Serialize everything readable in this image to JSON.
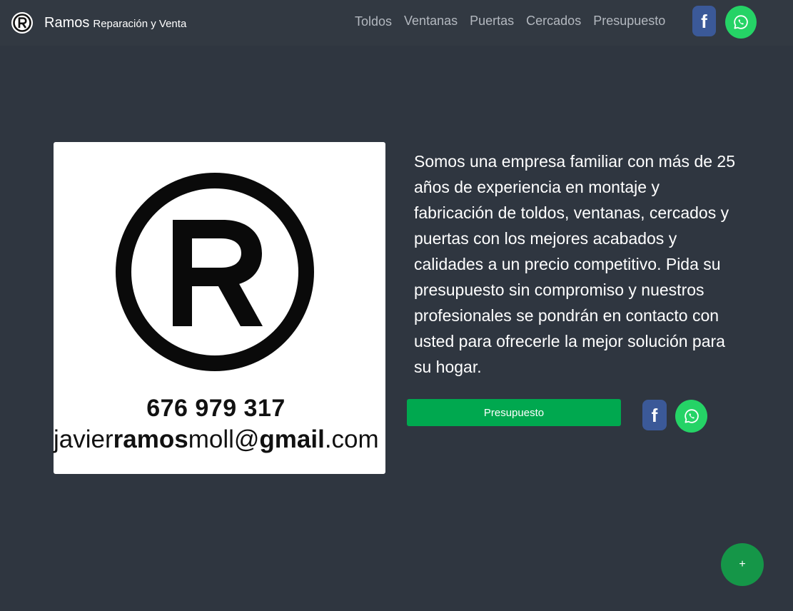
{
  "header": {
    "brand_name": "Ramos",
    "brand_sub": "Reparación y Venta",
    "nav": [
      "Toldos",
      "Ventanas",
      "Puertas",
      "Cercados",
      "Presupuesto"
    ],
    "icons": {
      "logo": "registered-trademark-icon",
      "facebook": "facebook-icon",
      "whatsapp": "whatsapp-icon"
    }
  },
  "card": {
    "phone": "676 979 317",
    "email_parts": {
      "a": "javier",
      "b": "ramos",
      "c": "moll@",
      "d": "gmail",
      "e": ".com"
    }
  },
  "main": {
    "description": "Somos una empresa familiar con más de 25 años de experiencia en montaje y fabricación de toldos, ventanas, cercados y puertas con los mejores acabados y calidades a un precio competitivo. Pida su presupuesto sin compromiso y nuestros profesionales se pondrán en contacto con usted para ofrecerle la mejor solución para su hogar.",
    "cta_label": "Presupuesto"
  },
  "fab": {
    "label": "+"
  },
  "colors": {
    "background": "#2f3640",
    "navbar": "#323942",
    "facebook": "#3b5998",
    "whatsapp": "#25d366",
    "cta": "#00a84f",
    "fab": "#159648"
  }
}
